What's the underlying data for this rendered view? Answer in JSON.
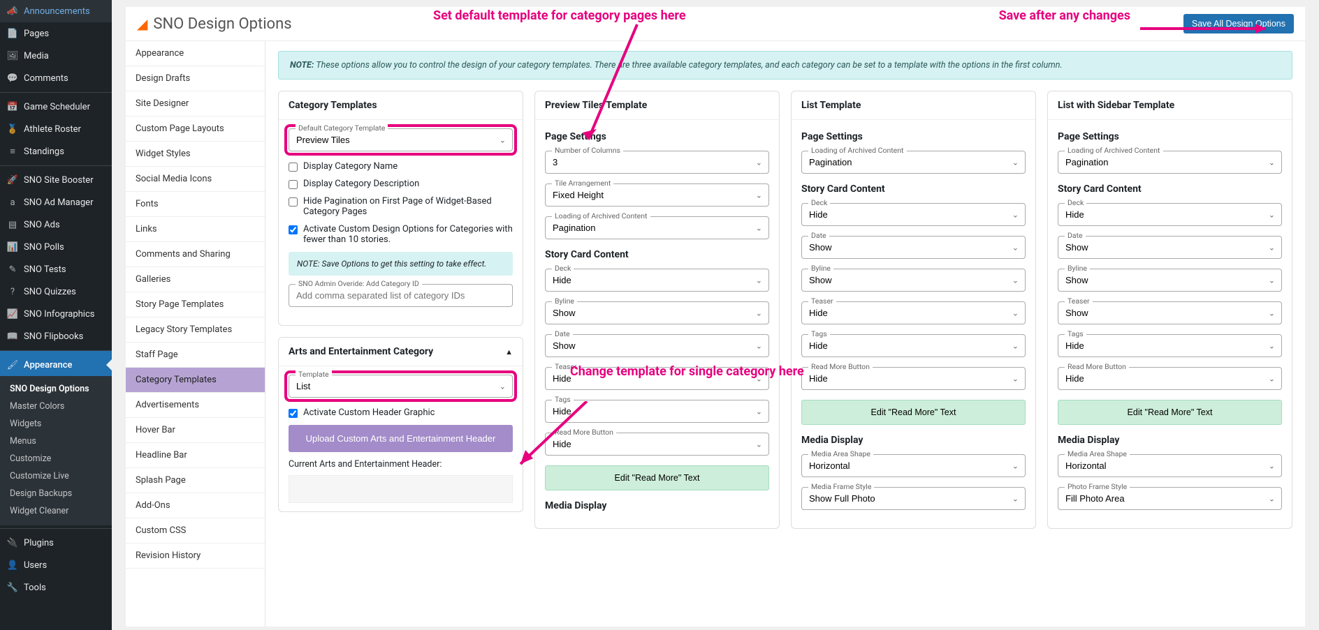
{
  "header": {
    "title": "SNO Design Options",
    "save_btn": "Save All Design Options"
  },
  "annotations": {
    "top": "Set default template for category pages here",
    "right": "Save after any changes",
    "mid": "Change template for single category here"
  },
  "wpSidebar": {
    "items": [
      {
        "label": "Announcements",
        "icon": "megaphone"
      },
      {
        "label": "Pages",
        "icon": "page"
      },
      {
        "label": "Media",
        "icon": "media"
      },
      {
        "label": "Comments",
        "icon": "comment"
      },
      {
        "label": "Game Scheduler",
        "icon": "calendar",
        "sep": true
      },
      {
        "label": "Athlete Roster",
        "icon": "roster"
      },
      {
        "label": "Standings",
        "icon": "list"
      },
      {
        "label": "SNO Site Booster",
        "icon": "rocket",
        "sep": true
      },
      {
        "label": "SNO Ad Manager",
        "icon": "a"
      },
      {
        "label": "SNO Ads",
        "icon": "ads"
      },
      {
        "label": "SNO Polls",
        "icon": "poll"
      },
      {
        "label": "SNO Tests",
        "icon": "test"
      },
      {
        "label": "SNO Quizzes",
        "icon": "quiz"
      },
      {
        "label": "SNO Infographics",
        "icon": "chart"
      },
      {
        "label": "SNO Flipbooks",
        "icon": "book"
      },
      {
        "label": "Appearance",
        "icon": "brush",
        "active": true,
        "sep": true
      },
      {
        "label": "Plugins",
        "icon": "plug",
        "sep": true
      },
      {
        "label": "Users",
        "icon": "user"
      },
      {
        "label": "Tools",
        "icon": "wrench"
      }
    ],
    "sub": [
      {
        "label": "SNO Design Options",
        "active": true
      },
      {
        "label": "Master Colors"
      },
      {
        "label": "Widgets"
      },
      {
        "label": "Menus"
      },
      {
        "label": "Customize"
      },
      {
        "label": "Customize Live"
      },
      {
        "label": "Design Backups"
      },
      {
        "label": "Widget Cleaner"
      }
    ]
  },
  "subnav": [
    "Appearance",
    "Design Drafts",
    "Site Designer",
    "Custom Page Layouts",
    "Widget Styles",
    "Social Media Icons",
    "Fonts",
    "Links",
    "Comments and Sharing",
    "Galleries",
    "Story Page Templates",
    "Legacy Story Templates",
    "Staff Page",
    "Category Templates",
    "Advertisements",
    "Hover Bar",
    "Headline Bar",
    "Splash Page",
    "Add-Ons",
    "Custom CSS",
    "Revision History"
  ],
  "subnav_active": "Category Templates",
  "note": "These options allow you to control the design of your category templates. There are three available category templates, and each category can be set to a template with the options in the first column.",
  "col1": {
    "card1_title": "Category Templates",
    "default_template_label": "Default Category Template",
    "default_template_value": "Preview Tiles",
    "chk_display_name": "Display Category Name",
    "chk_display_desc": "Display Category Description",
    "chk_hide_pag": "Hide Pagination on First Page of Widget-Based Category Pages",
    "chk_activate_custom": "Activate Custom Design Options for Categories with fewer than 10 stories.",
    "mini_note": "NOTE: Save Options to get this setting to take effect.",
    "override_label": "SNO Admin Overide: Add Category ID",
    "override_placeholder": "Add comma separated list of category IDs",
    "card2_title": "Arts and Entertainment Category",
    "template_label": "Template",
    "template_value": "List",
    "chk_activate_header": "Activate Custom Header Graphic",
    "upload_btn": "Upload Custom Arts and Entertainment Header",
    "current_header": "Current Arts and Entertainment Header:"
  },
  "col2": {
    "title": "Preview Tiles Template",
    "page_settings": "Page Settings",
    "num_cols_label": "Number of Columns",
    "num_cols_value": "3",
    "tile_arr_label": "Tile Arrangement",
    "tile_arr_value": "Fixed Height",
    "load_arch_label": "Loading of Archived Content",
    "load_arch_value": "Pagination",
    "scc": "Story Card Content",
    "deck_label": "Deck",
    "deck_value": "Hide",
    "byline_label": "Byline",
    "byline_value": "Show",
    "date_label": "Date",
    "date_value": "Show",
    "teaser_label": "Teaser",
    "teaser_value": "Hide",
    "tags_label": "Tags",
    "tags_value": "Hide",
    "rmb_label": "Read More Button",
    "rmb_value": "Hide",
    "edit_rm": "Edit \"Read More\" Text",
    "media": "Media Display"
  },
  "col3": {
    "title": "List Template",
    "page_settings": "Page Settings",
    "load_arch_label": "Loading of Archived Content",
    "load_arch_value": "Pagination",
    "scc": "Story Card Content",
    "deck_label": "Deck",
    "deck_value": "Hide",
    "date_label": "Date",
    "date_value": "Show",
    "byline_label": "Byline",
    "byline_value": "Show",
    "teaser_label": "Teaser",
    "teaser_value": "Hide",
    "tags_label": "Tags",
    "tags_value": "Hide",
    "rmb_label": "Read More Button",
    "rmb_value": "Hide",
    "edit_rm": "Edit \"Read More\" Text",
    "media": "Media Display",
    "mas_label": "Media Area Shape",
    "mas_value": "Horizontal",
    "mfs_label": "Media Frame Style",
    "mfs_value": "Show Full Photo"
  },
  "col4": {
    "title": "List with Sidebar Template",
    "page_settings": "Page Settings",
    "load_arch_label": "Loading of Archived Content",
    "load_arch_value": "Pagination",
    "scc": "Story Card Content",
    "deck_label": "Deck",
    "deck_value": "Hide",
    "date_label": "Date",
    "date_value": "Show",
    "byline_label": "Byline",
    "byline_value": "Show",
    "teaser_label": "Teaser",
    "teaser_value": "Show",
    "tags_label": "Tags",
    "tags_value": "Hide",
    "rmb_label": "Read More Button",
    "rmb_value": "Hide",
    "edit_rm": "Edit \"Read More\" Text",
    "media": "Media Display",
    "mas_label": "Media Area Shape",
    "mas_value": "Horizontal",
    "pfs_label": "Photo Frame Style",
    "pfs_value": "Fill Photo Area"
  }
}
